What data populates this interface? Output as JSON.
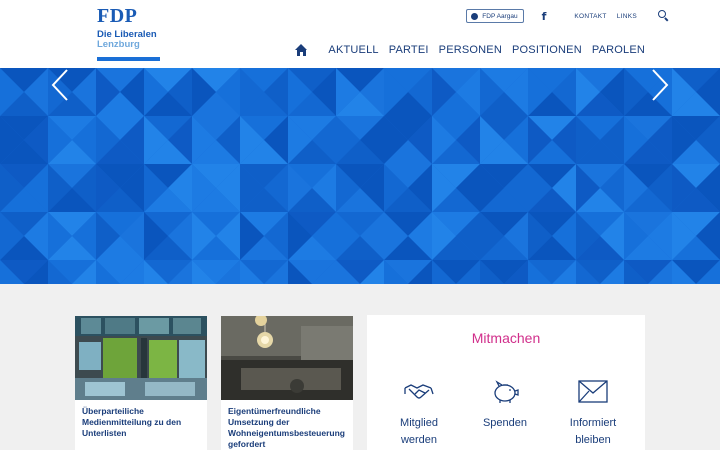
{
  "logo": {
    "title": "FDP",
    "subtitle": "Die Liberalen",
    "location": "Lenzburg"
  },
  "top_links": {
    "region_button": "FDP Aargau",
    "region_icon": "globe-icon",
    "facebook": "f",
    "kontakt": "KONTAKT",
    "links": "LINKS",
    "search_icon": "search-icon"
  },
  "main_nav": {
    "home_icon": "home-icon",
    "items": [
      "AKTUELL",
      "PARTEI",
      "PERSONEN",
      "POSITIONEN",
      "PAROLEN"
    ]
  },
  "hero": {
    "prev_icon": "chevron-left-icon",
    "next_icon": "chevron-right-icon",
    "base_color": "#1469d4"
  },
  "news_cards": [
    {
      "caption": "Überparteiliche Medienmitteilung zu den Unterlisten"
    },
    {
      "caption": "Eigentümerfreundliche Umsetzung der Wohneigentumsbesteuerung gefordert"
    }
  ],
  "mitmachen": {
    "title": "Mitmachen",
    "items": [
      {
        "label_1": "Mitglied",
        "label_2": "werden",
        "icon": "handshake-icon"
      },
      {
        "label_1": "Spenden",
        "label_2": "",
        "icon": "piggy-bank-icon"
      },
      {
        "label_1": "Informiert",
        "label_2": "bleiben",
        "icon": "envelope-icon"
      }
    ]
  },
  "colors": {
    "brand_blue": "#1a5bb5",
    "nav_text": "#1a3d7a",
    "accent_pink": "#d12f8b"
  }
}
